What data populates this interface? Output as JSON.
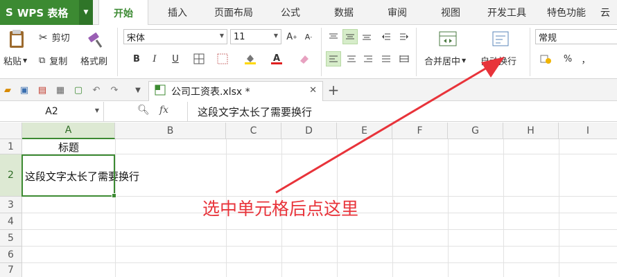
{
  "app": {
    "name": "WPS 表格"
  },
  "menu": {
    "tabs": [
      "开始",
      "插入",
      "页面布局",
      "公式",
      "数据",
      "审阅",
      "视图",
      "开发工具",
      "特色功能",
      "云"
    ]
  },
  "ribbon": {
    "paste": "粘贴",
    "cut": "剪切",
    "copy": "复制",
    "format_painter": "格式刷",
    "font_name": "宋体",
    "font_size": "11",
    "bold": "B",
    "italic": "I",
    "underline": "U",
    "merge_center": "合并居中",
    "wrap_text": "自动换行",
    "number_format": "常规",
    "percent": "%",
    "comma": "，"
  },
  "document": {
    "tab_title": "公司工资表.xlsx *"
  },
  "formula_bar": {
    "name_box": "A2",
    "fx": "fx",
    "content": "这段文字太长了需要换行"
  },
  "sheet": {
    "columns": [
      "A",
      "B",
      "C",
      "D",
      "E",
      "F",
      "G",
      "H",
      "I"
    ],
    "rows": [
      "1",
      "2",
      "3",
      "4",
      "5",
      "6",
      "7"
    ],
    "cells": {
      "A1": "标题",
      "A2": "这段文字太长了需要换行"
    }
  },
  "annotation": {
    "text": "选中单元格后点这里",
    "color": "#e8333a"
  },
  "colors": {
    "brand": "#3c8a32",
    "accent_selected": "#d6ecc9"
  }
}
